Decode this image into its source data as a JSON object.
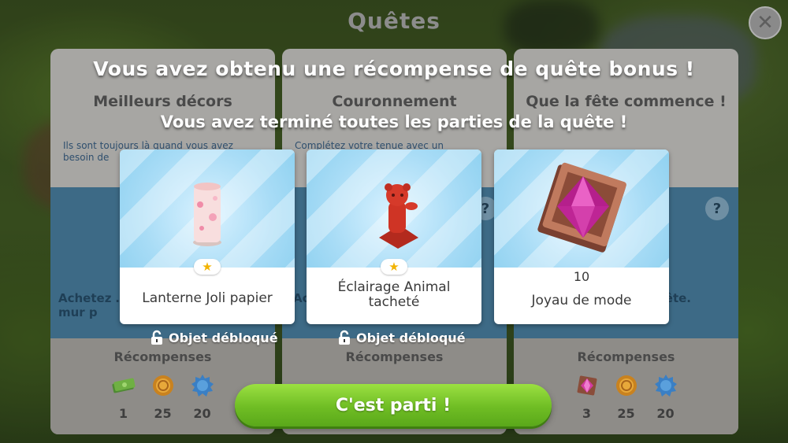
{
  "screen": {
    "title": "Quêtes"
  },
  "headline": "Vous avez obtenu une récompense de quête bonus !",
  "subline": "Vous avez terminé toutes les parties de la quête !",
  "quests": [
    {
      "title": "Meilleurs décors",
      "desc": "Ils sont toujours là quand vous avez besoin de",
      "mid": "Achetez … mur p",
      "rewards_label": "Récompenses",
      "rewards": [
        {
          "icon": "cash-stack-icon",
          "value": "1"
        },
        {
          "icon": "coin-icon",
          "value": "25"
        },
        {
          "icon": "xp-star-icon",
          "value": "20"
        }
      ]
    },
    {
      "title": "Couronnement",
      "desc": "Complétez votre tenue avec un",
      "mid": "Ac",
      "rewards_label": "Récompenses",
      "rewards": []
    },
    {
      "title": "Que la fête commence !",
      "desc": "",
      "mid": "ête.",
      "rewards_label": "Récompenses",
      "rewards": [
        {
          "icon": "gem-icon",
          "value": "3"
        },
        {
          "icon": "coin-icon",
          "value": "25"
        },
        {
          "icon": "xp-star-icon",
          "value": "20"
        }
      ]
    }
  ],
  "rewards": [
    {
      "name": "Lanterne Joli papier",
      "icon": "lantern-icon",
      "unlock": "Objet débloqué"
    },
    {
      "name": "Éclairage Animal tacheté",
      "icon": "animal-lamp-icon",
      "unlock": "Objet débloqué"
    },
    {
      "name": "Joyau de mode",
      "icon": "fashion-gem-icon",
      "count": "10"
    }
  ],
  "button": {
    "label": "C'est parti !"
  },
  "colors": {
    "accent_green": "#6fbd24",
    "card_sky": "#a8dcf6",
    "star": "#f2b300"
  }
}
